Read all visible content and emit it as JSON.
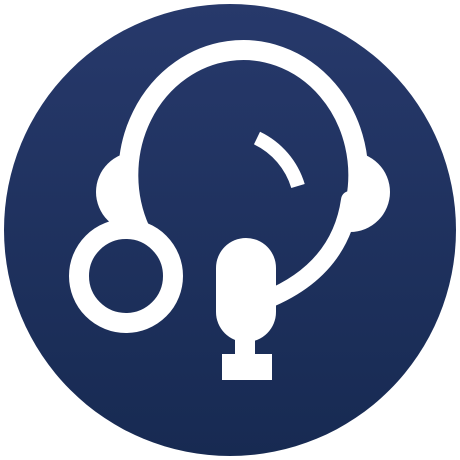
{
  "icon": {
    "name": "headset-microphone-icon",
    "colors": {
      "background_top": "#27396b",
      "background_bottom": "#172a52",
      "glyph": "#ffffff",
      "page": "#ffffff"
    }
  }
}
